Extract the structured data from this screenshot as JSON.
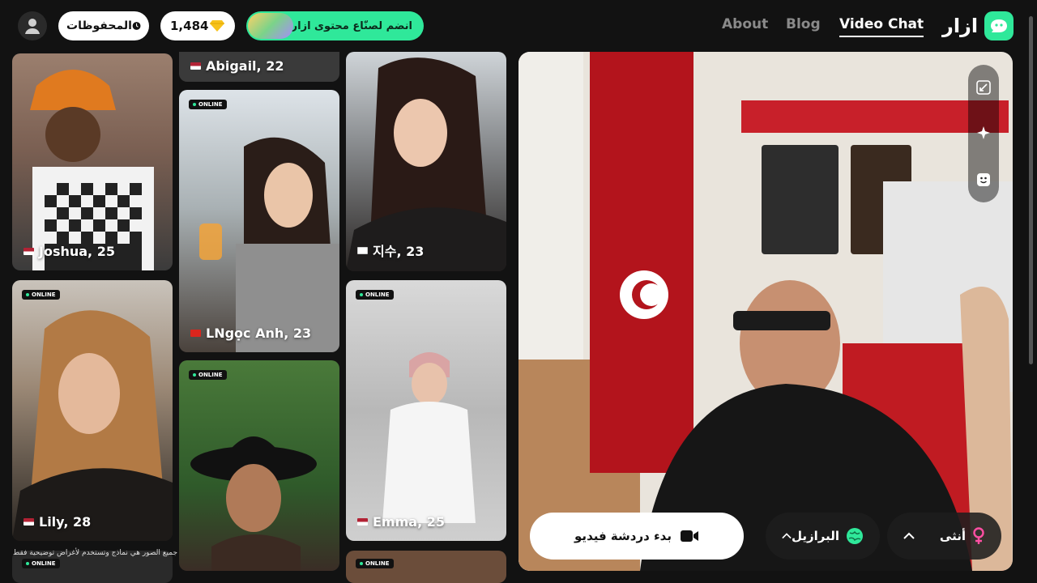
{
  "header": {
    "saved_label": "المحفوظات",
    "coins": "1,484",
    "join_label": "انضم لصنّاع محتوى ازار",
    "nav": [
      "About",
      "Blog",
      "Video Chat"
    ],
    "brand": "ازار"
  },
  "cards": [
    {
      "name": "Joshua, 25",
      "flag": "us"
    },
    {
      "name": "Abigail, 22",
      "flag": "us"
    },
    {
      "name": "LNgọc Anh, 23",
      "flag": "vn",
      "badge": "ONLINE"
    },
    {
      "name": "지수, 23",
      "flag": "kr"
    },
    {
      "name": "Lily, 28",
      "flag": "us",
      "badge": "ONLINE"
    },
    {
      "name": "Emma, 25",
      "flag": "us",
      "badge": "ONLINE"
    },
    {
      "badge": "ONLINE"
    },
    {
      "badge": "ONLINE"
    },
    {
      "badge": "ONLINE"
    }
  ],
  "caption": "جميع الصور هي نماذج وتستخدم لأغراض توضيحية فقط",
  "controls": {
    "start_label": "بدء دردشة فيديو",
    "country_label": "البرازيل",
    "gender_label": "أنثى"
  },
  "colors": {
    "accent": "#2fe89a",
    "background": "#121212"
  }
}
